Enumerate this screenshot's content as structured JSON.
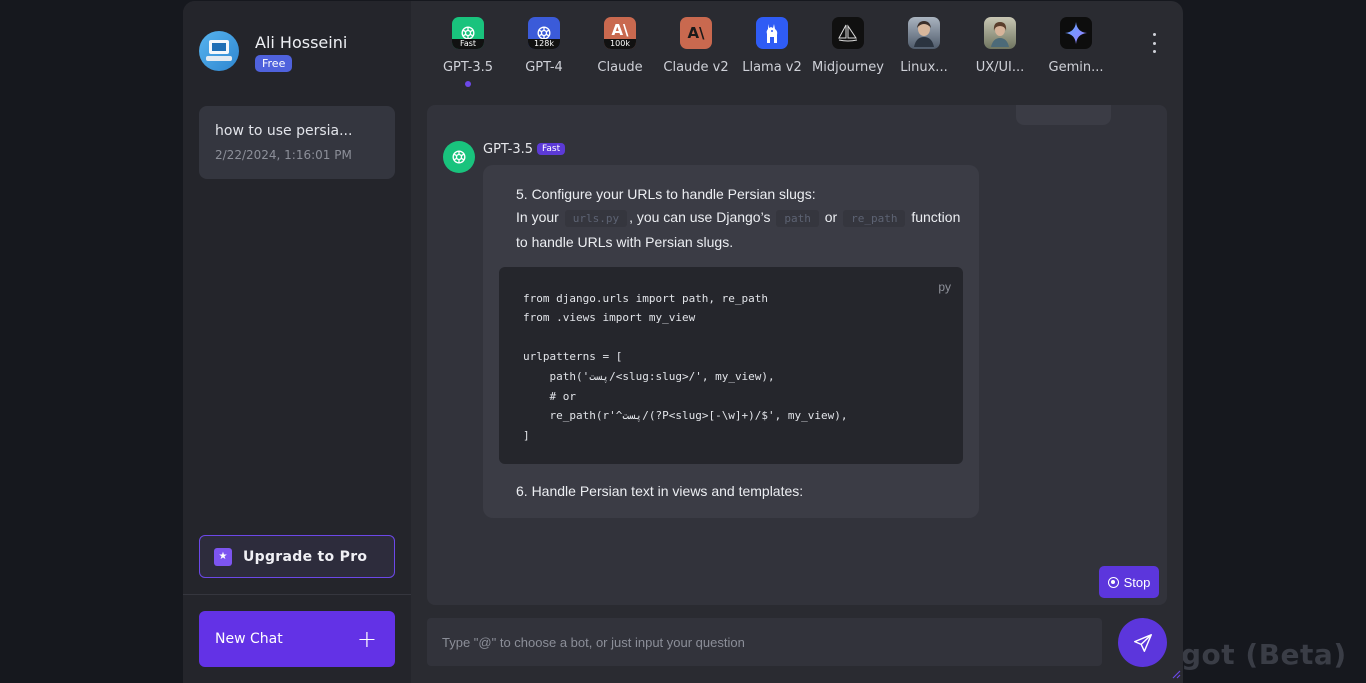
{
  "watermark": "got (Beta)",
  "user": {
    "name": "Ali Hosseini",
    "plan": "Free"
  },
  "history": [
    {
      "title": "how to use persia...",
      "date": "2/22/2024, 1:16:01 PM"
    }
  ],
  "sidebar": {
    "upgrade_label": "Upgrade to Pro",
    "new_chat_label": "New Chat"
  },
  "bots": [
    {
      "label": "GPT-3.5",
      "tag": "Fast",
      "color": "#19c37d",
      "icon": "openai-icon",
      "active": true
    },
    {
      "label": "GPT-4",
      "tag": "128k",
      "color": "#3b5bd9",
      "icon": "openai-icon"
    },
    {
      "label": "Claude",
      "tag": "100k",
      "color": "#c9694f",
      "icon": "anthropic-icon"
    },
    {
      "label": "Claude v2",
      "tag": "",
      "color": "#c9694f",
      "icon": "anthropic-icon"
    },
    {
      "label": "Llama v2",
      "tag": "",
      "color": "#2f5cf5",
      "icon": "llama-icon"
    },
    {
      "label": "Midjourney",
      "tag": "",
      "color": "#101010",
      "icon": "sailboat-icon"
    },
    {
      "label": "Linux...",
      "tag": "",
      "color": "#6a7788",
      "icon": "portrait-icon"
    },
    {
      "label": "UX/UI...",
      "tag": "",
      "color": "#7a7d6c",
      "icon": "portrait-icon"
    },
    {
      "label": "Gemin...",
      "tag": "",
      "color": "#0d0d0d",
      "icon": "sparkle-icon"
    }
  ],
  "message": {
    "bot_name": "GPT-3.5",
    "bot_badge": "Fast",
    "step5_heading": "5. Configure your URLs to handle Persian slugs:",
    "line2_a": "In your",
    "line2_code1": "urls.py",
    "line2_b": ", you can use Django’s",
    "line2_code2": "path",
    "line2_c": "or",
    "line2_code3": "re_path",
    "line2_d": "function",
    "line3": "to handle URLs with Persian slugs.",
    "code_lang": "py",
    "code_lines": [
      "from django.urls import path, re_path",
      "from .views import my_view",
      "",
      "urlpatterns = [",
      "    path('پست/<slug:slug>/', my_view),",
      "    # or",
      "    re_path(r'^پست/(?P<slug>[-\\w]+)/$', my_view),",
      "]"
    ],
    "step6_heading": "6. Handle Persian text in views and templates:"
  },
  "stop_label": "Stop",
  "input": {
    "placeholder": "Type \"@\" to choose a bot, or just input your question",
    "value": ""
  }
}
